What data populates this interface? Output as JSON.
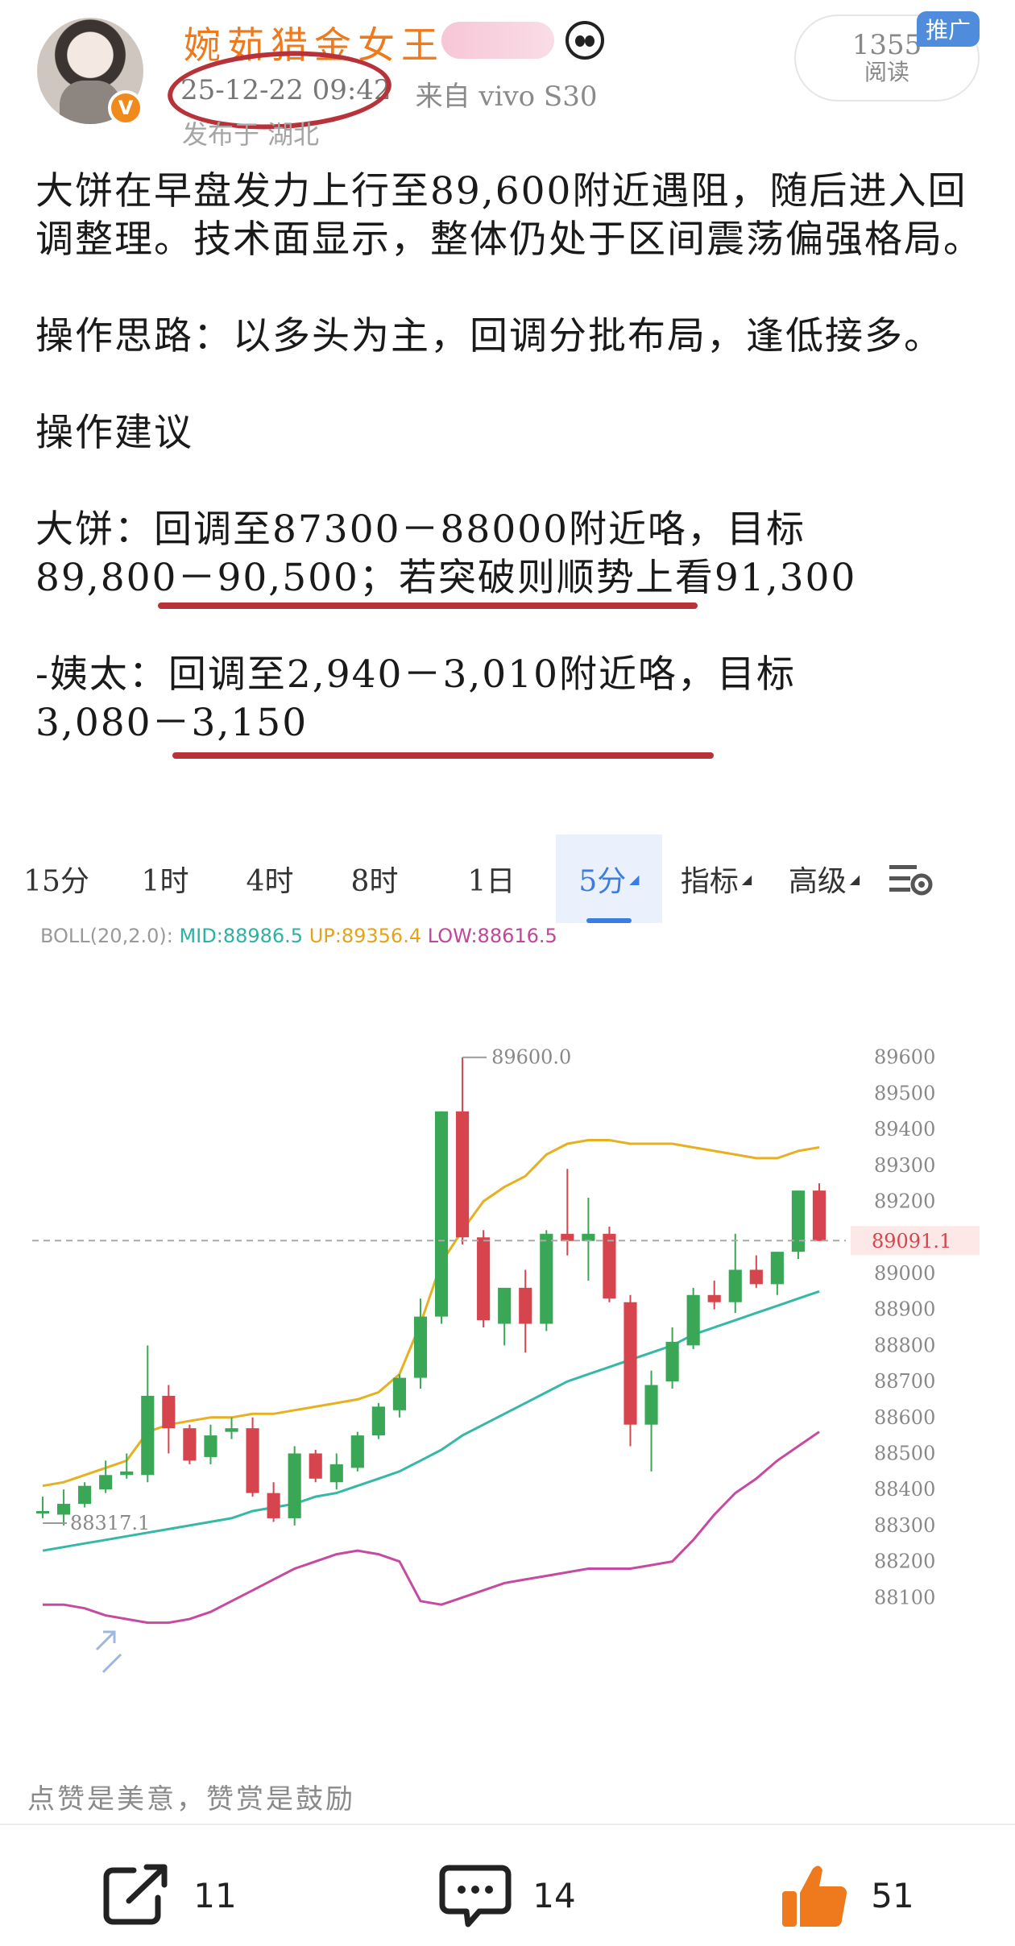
{
  "header": {
    "username": "婉茹猎金女王",
    "time": "25-12-22 09:42",
    "source": "来自 vivo S30",
    "location": "发布于 湖北",
    "read_count": "1355",
    "read_label": "阅读",
    "promo_tag": "推广"
  },
  "post": {
    "para1": "大饼在早盘发力上行至89,600附近遇阻，随后进入回调整理。技术面显示，整体仍处于区间震荡偏强格局。",
    "para2": "操作思路：以多头为主，回调分批布局，逢低接多。",
    "para3": "操作建议",
    "btc_prefix": "大饼：",
    "btc_key": "回调至87300－88000附近咯",
    "btc_rest": "，目标",
    "btc_line2": "89,800－90,500；若突破则顺势上看91,300",
    "eth_prefix": "-姨太：",
    "eth_key": "回调至2,940－3,010附近咯",
    "eth_rest": "，目标",
    "eth_line2": "3,080－3,150"
  },
  "tabs": [
    {
      "label": "15分"
    },
    {
      "label": "1时"
    },
    {
      "label": "4时"
    },
    {
      "label": "8时"
    },
    {
      "label": "1日"
    },
    {
      "label": "5分"
    },
    {
      "label": "指标"
    },
    {
      "label": "高级"
    }
  ],
  "chart_data": {
    "type": "candlestick",
    "indicator_text": "BOLL(20,2.0):",
    "mid_text": "MID:88986.5",
    "up_text": "UP:89356.4",
    "low_text": "LOW:88616.5",
    "y_ticks": [
      "89600",
      "89500",
      "89400",
      "89300",
      "89200",
      "89000",
      "88900",
      "88800",
      "88700",
      "88600",
      "88500",
      "88400",
      "88300",
      "88200",
      "88100"
    ],
    "ylim": [
      88000,
      89700
    ],
    "current_price": "89091.1",
    "current_value": 89091.1,
    "high_label": "89600.0",
    "low_label": "88317.1",
    "candles": [
      {
        "o": 88340,
        "h": 88380,
        "l": 88320,
        "c": 88340
      },
      {
        "o": 88330,
        "h": 88400,
        "l": 88300,
        "c": 88360
      },
      {
        "o": 88360,
        "h": 88420,
        "l": 88350,
        "c": 88410
      },
      {
        "o": 88400,
        "h": 88480,
        "l": 88390,
        "c": 88440
      },
      {
        "o": 88440,
        "h": 88500,
        "l": 88430,
        "c": 88450
      },
      {
        "o": 88440,
        "h": 88800,
        "l": 88420,
        "c": 88660
      },
      {
        "o": 88660,
        "h": 88690,
        "l": 88500,
        "c": 88570
      },
      {
        "o": 88570,
        "h": 88580,
        "l": 88470,
        "c": 88480
      },
      {
        "o": 88490,
        "h": 88580,
        "l": 88470,
        "c": 88550
      },
      {
        "o": 88560,
        "h": 88600,
        "l": 88540,
        "c": 88570
      },
      {
        "o": 88570,
        "h": 88600,
        "l": 88380,
        "c": 88390
      },
      {
        "o": 88390,
        "h": 88420,
        "l": 88310,
        "c": 88320
      },
      {
        "o": 88320,
        "h": 88520,
        "l": 88300,
        "c": 88500
      },
      {
        "o": 88500,
        "h": 88510,
        "l": 88420,
        "c": 88430
      },
      {
        "o": 88420,
        "h": 88500,
        "l": 88400,
        "c": 88470
      },
      {
        "o": 88460,
        "h": 88560,
        "l": 88450,
        "c": 88550
      },
      {
        "o": 88550,
        "h": 88640,
        "l": 88540,
        "c": 88630
      },
      {
        "o": 88620,
        "h": 88720,
        "l": 88600,
        "c": 88710
      },
      {
        "o": 88710,
        "h": 88930,
        "l": 88680,
        "c": 88880
      },
      {
        "o": 88880,
        "h": 89450,
        "l": 88860,
        "c": 89450
      },
      {
        "o": 89450,
        "h": 89600,
        "l": 89080,
        "c": 89100
      },
      {
        "o": 89100,
        "h": 89120,
        "l": 88850,
        "c": 88870
      },
      {
        "o": 88860,
        "h": 88950,
        "l": 88800,
        "c": 88960
      },
      {
        "o": 88960,
        "h": 89010,
        "l": 88780,
        "c": 88860
      },
      {
        "o": 88860,
        "h": 89120,
        "l": 88840,
        "c": 89110
      },
      {
        "o": 89110,
        "h": 89290,
        "l": 89050,
        "c": 89090
      },
      {
        "o": 89090,
        "h": 89210,
        "l": 88980,
        "c": 89110
      },
      {
        "o": 89110,
        "h": 89130,
        "l": 88920,
        "c": 88930
      },
      {
        "o": 88920,
        "h": 88940,
        "l": 88520,
        "c": 88580
      },
      {
        "o": 88580,
        "h": 88730,
        "l": 88450,
        "c": 88690
      },
      {
        "o": 88700,
        "h": 88850,
        "l": 88680,
        "c": 88810
      },
      {
        "o": 88800,
        "h": 88960,
        "l": 88790,
        "c": 88940
      },
      {
        "o": 88940,
        "h": 88980,
        "l": 88900,
        "c": 88920
      },
      {
        "o": 88920,
        "h": 89110,
        "l": 88890,
        "c": 89010
      },
      {
        "o": 89010,
        "h": 89050,
        "l": 88960,
        "c": 88970
      },
      {
        "o": 88970,
        "h": 89060,
        "l": 88940,
        "c": 89060
      },
      {
        "o": 89060,
        "h": 89230,
        "l": 89040,
        "c": 89230
      },
      {
        "o": 89230,
        "h": 89250,
        "l": 89090,
        "c": 89090
      }
    ],
    "boll_mid": [
      88230,
      88240,
      88250,
      88260,
      88270,
      88280,
      88290,
      88300,
      88310,
      88320,
      88340,
      88350,
      88360,
      88380,
      88390,
      88410,
      88430,
      88450,
      88480,
      88510,
      88550,
      88580,
      88610,
      88640,
      88670,
      88700,
      88720,
      88740,
      88760,
      88780,
      88800,
      88830,
      88850,
      88870,
      88890,
      88910,
      88930,
      88950
    ],
    "boll_up": [
      88410,
      88420,
      88440,
      88460,
      88480,
      88560,
      88580,
      88590,
      88600,
      88600,
      88610,
      88610,
      88620,
      88630,
      88640,
      88650,
      88670,
      88720,
      88860,
      89030,
      89120,
      89200,
      89240,
      89270,
      89330,
      89360,
      89370,
      89370,
      89360,
      89360,
      89360,
      89350,
      89340,
      89330,
      89320,
      89320,
      89340,
      89350
    ],
    "boll_low": [
      88080,
      88080,
      88070,
      88050,
      88040,
      88030,
      88030,
      88040,
      88060,
      88090,
      88120,
      88150,
      88180,
      88200,
      88220,
      88230,
      88220,
      88200,
      88090,
      88080,
      88100,
      88120,
      88140,
      88150,
      88160,
      88170,
      88180,
      88180,
      88180,
      88190,
      88200,
      88260,
      88330,
      88390,
      88430,
      88480,
      88520,
      88560
    ]
  },
  "footnote": "点赞是美意，赞赏是鼓励",
  "actions": {
    "repost_count": "11",
    "comment_count": "14",
    "like_count": "51"
  },
  "colors": {
    "accent_orange": "#ef7a1d",
    "annotation_red": "#b8323a",
    "up_green": "#3aa757",
    "down_red": "#d6454d",
    "tab_blue": "#3b7de0"
  }
}
